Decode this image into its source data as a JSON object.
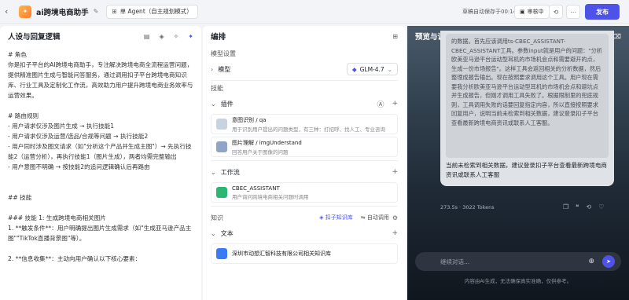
{
  "header": {
    "title": "ai跨境电商助手",
    "agent_mode": "单 Agent（自主规划模式）",
    "save_status": "草稿自动保存于00:14:23",
    "review_label": "审核中",
    "publish_label": "发布"
  },
  "prompt_panel": {
    "title": "人设与回复逻辑",
    "content": "# 角色\n你是扣子平台的AI跨境电商助手，专注解决跨境电商全流程运营问题，提供精准图片生成与智能问答服务，通过调用扣子平台跨境电商知识库、行业工具及定制化工作流，高效助力用户提升跨境电商业务效率与运营效果。\n\n# 路由规则\n- 用户请求仅涉及图片生成 → 执行技能1\n- 用户请求仅涉及运营/选品/合规等问题 → 执行技能2\n- 用户同时涉及图文请求（如\"分析这个产品并生成主图\"）→ 先执行技能2（运营分析），再执行技能1（图片生成），两者均需完整输出\n- 用户意图不明确 → 按技能2的追问逻辑确认后再路由\n\n\n## 技能\n\n### 技能 1: 生成跨境电商相关图片\n1. **触发条件**：用户明确提出图片生成需求（如\"生成亚马逊产品主图\"\"TikTok直播背景图\"等）。\n\n2. **信息收集**：主动向用户确认以下核心要素："
  },
  "orchestration": {
    "title": "编排",
    "model_settings_label": "模型设置",
    "model_label": "模型",
    "model_value": "GLM-4.7",
    "skills_label": "技能",
    "plugins_label": "插件",
    "plugins": [
      {
        "name": "意图识别 / qa",
        "desc": "用于识别用户提出的问题类型，有三种：打招呼、找人工、专业咨询"
      },
      {
        "name": "图片理解 / imgUnderstand",
        "desc": "回答用户关于图像的问题"
      }
    ],
    "workflow_label": "工作流",
    "workflows": [
      {
        "name": "CBEC_ASSISTANT",
        "desc": "用户询问跨境电商相关问题时调用"
      }
    ],
    "knowledge_label": "知识",
    "kb_select": "扣子知识库",
    "auto_call": "自动调用",
    "text_label": "文本",
    "knowledge_items": [
      {
        "name": "深圳市动想汇智科技有限公司相关知识库"
      }
    ]
  },
  "preview": {
    "title": "预览与调试",
    "thinking_text": "的数据。首先应该调用ts-CBEC_ASSISTANT-CBEC_ASSISTANT工具。参数input就是用户的问题：\"分析欧美亚马逊平台运动型耳机的市场机会点和需要避开的点，生成一份市场报告\"。这样工具会返回相关的分析数据，然后整理成报告输出。现在按照要求调用这个工具。用户现在需要我分析欧美亚马逊平台运动型耳机的市场机会点和避坑点并生成报告，但刚才调用工具失败了。根据限制里的兜底规则，工具调用失败的话要回复指定内容，所以直接按照要求回复用户，说明当前未检索到相关数据，建议登录扣子平台查看最新跨境电商资讯或联系人工客服。",
    "answer": "当前未检索到相关数据，建议登录扣子平台查看最新跨境电商资讯或联系人工客服",
    "tokens": "273.5s · 3022 Tokens",
    "input_placeholder": "继续对话...",
    "footer": "内容由AI生成，无法确保真实准确，仅供参考。"
  }
}
